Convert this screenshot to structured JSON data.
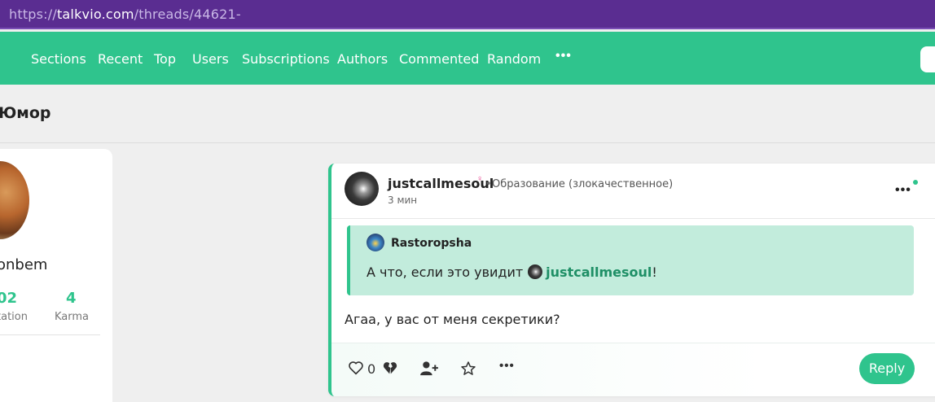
{
  "browser": {
    "url_protocol": "https://",
    "url_host": "talkvio.com",
    "url_path": "/threads/44621-"
  },
  "nav": {
    "items": [
      {
        "label": "Sections"
      },
      {
        "label": "Recent"
      },
      {
        "label": "Top"
      },
      {
        "label": "Users"
      },
      {
        "label": "Subscriptions"
      },
      {
        "label": "Authors"
      },
      {
        "label": "Commented"
      },
      {
        "label": "Random"
      }
    ],
    "more_label": "•••"
  },
  "section": {
    "title": "Юмор"
  },
  "profile": {
    "name": "onbem",
    "stats": [
      {
        "value": "02",
        "label": "tation"
      },
      {
        "value": "4",
        "label": "Karma"
      }
    ]
  },
  "post": {
    "author": "justcallmesoul",
    "gender_icon": "female-sign-icon",
    "separator": "•",
    "status": "Образование (злокачественное)",
    "time": "3 мин",
    "menu_label": "•••",
    "quote": {
      "author": "Rastoropsha",
      "text_before": "А что, если это увидит",
      "mention": "justcallmesoul",
      "text_after": "!"
    },
    "body": "Агаа, у вас от меня секретики?",
    "likes": "0",
    "more_label": "•••",
    "reply_label": "Reply"
  },
  "colors": {
    "accent": "#2fc48d",
    "url_bar": "#5a2d91",
    "quote_bg": "#c2ecdc",
    "mention": "#1e8f66"
  }
}
